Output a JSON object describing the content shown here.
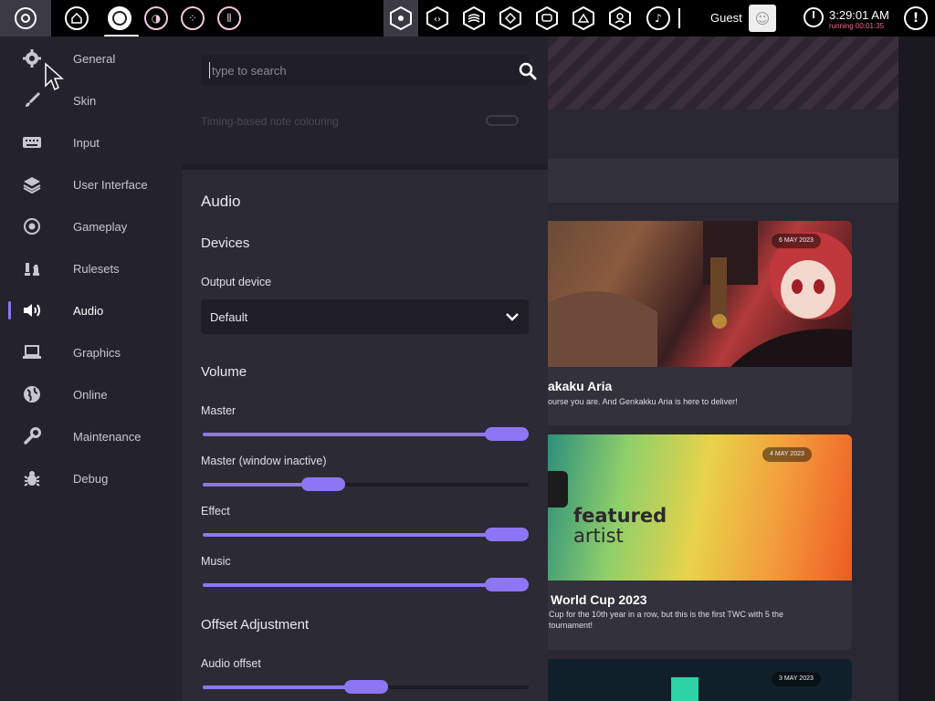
{
  "toolbar": {
    "settings_icon": "gear-icon",
    "home_icon": "home-icon",
    "rulesets": [
      "osu",
      "taiko",
      "catch",
      "mania"
    ],
    "beatmap_icons": [
      "beatmap-listing-icon",
      "chat-icon",
      "activity-icon",
      "rankings-icon",
      "news-icon",
      "changelog-icon",
      "multiplayer-icon",
      "music-icon"
    ],
    "user_name": "Guest",
    "clock_time": "3:29:01 AM",
    "clock_running": "running 00:01:35",
    "notifications_icon": "exclamation-icon"
  },
  "sidebar": {
    "items": [
      {
        "label": "General",
        "icon": "gear-icon"
      },
      {
        "label": "Skin",
        "icon": "paintbrush-icon"
      },
      {
        "label": "Input",
        "icon": "keyboard-icon"
      },
      {
        "label": "User Interface",
        "icon": "layers-icon"
      },
      {
        "label": "Gameplay",
        "icon": "target-icon"
      },
      {
        "label": "Rulesets",
        "icon": "chess-icon"
      },
      {
        "label": "Audio",
        "icon": "speaker-icon"
      },
      {
        "label": "Graphics",
        "icon": "laptop-icon"
      },
      {
        "label": "Online",
        "icon": "globe-icon"
      },
      {
        "label": "Maintenance",
        "icon": "wrench-icon"
      },
      {
        "label": "Debug",
        "icon": "bug-icon"
      }
    ],
    "active": "Audio"
  },
  "settings": {
    "search_placeholder": "type to search",
    "faded_setting": "Timing-based note colouring",
    "section_title": "Audio",
    "devices_title": "Devices",
    "output_device_label": "Output device",
    "output_device_value": "Default",
    "volume_title": "Volume",
    "master_label": "Master",
    "master_value": 1.0,
    "master_inactive_label": "Master (window inactive)",
    "master_inactive_value": 0.35,
    "effect_label": "Effect",
    "effect_value": 1.0,
    "music_label": "Music",
    "music_value": 1.0,
    "offset_title": "Offset Adjustment",
    "audio_offset_label": "Audio offset",
    "audio_offset_value": 0.5
  },
  "news": {
    "cards": [
      {
        "date": "6 MAY 2023",
        "title": "akaku Aria",
        "desc": "ourse you are. And Genkakku Aria is here to deliver!"
      },
      {
        "date": "4 MAY 2023",
        "title": "World Cup 2023",
        "desc": "Cup for the 10th year in a row, but this is the first TWC with 5 the tournament!",
        "image_text_1": "featured",
        "image_text_2": "artist"
      },
      {
        "date": "3 MAY 2023",
        "title": "",
        "desc": ""
      }
    ]
  },
  "colors": {
    "accent": "#8d76f5",
    "panel": "#2c2a34",
    "sidebar": "#24222b",
    "running": "#f06a8e"
  }
}
